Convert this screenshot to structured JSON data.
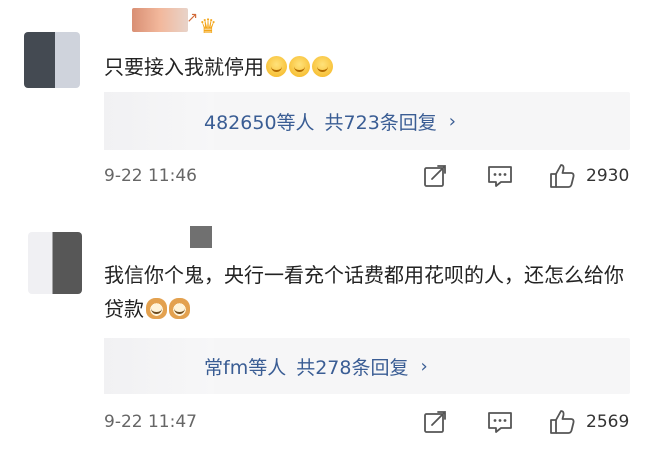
{
  "comments": [
    {
      "text": "只要接入我就停用",
      "emojis": [
        "smile",
        "smile",
        "smile"
      ],
      "reply": {
        "names": "482650等人",
        "count_label": "共723条回复"
      },
      "time": "9-22  11:46",
      "likes": "2930"
    },
    {
      "text": "我信你个鬼，央行一看充个话费都用花呗的人，还怎么给你贷款",
      "emojis": [
        "doge",
        "doge"
      ],
      "reply": {
        "names": "常fm等人",
        "count_label": "共278条回复"
      },
      "time": "9-22  11:47",
      "likes": "2569"
    }
  ],
  "icons": {
    "badge": "crown-badge-icon",
    "share": "share-icon",
    "comment": "comment-icon",
    "like": "thumbs-up-icon",
    "chevron": "chevron-right-icon"
  },
  "colors": {
    "link": "#3a5d94",
    "reply_bg": "#f6f6f7",
    "meta_text": "#666666"
  }
}
